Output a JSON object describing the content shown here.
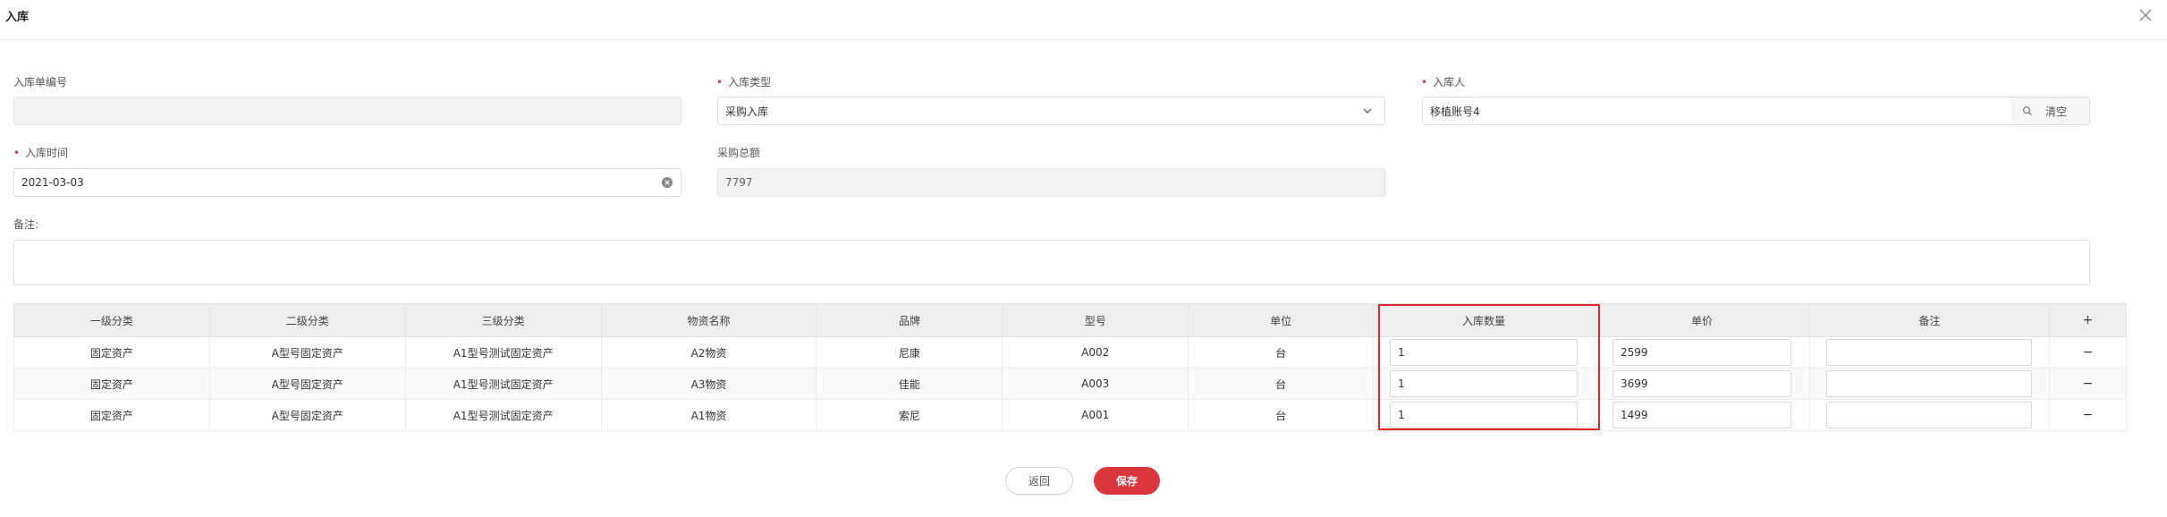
{
  "dialog": {
    "title": "入库"
  },
  "form": {
    "order_no": {
      "label": "入库单编号",
      "value": ""
    },
    "type": {
      "label": "入库类型",
      "value": "采购入库"
    },
    "person": {
      "label": "入库人",
      "value": "移植账号4",
      "clear_label": "清空"
    },
    "date": {
      "label": "入库时间",
      "value": "2021-03-03"
    },
    "total": {
      "label": "采购总额",
      "value": "7797"
    },
    "remark": {
      "label": "备注:"
    }
  },
  "table": {
    "columns": [
      "一级分类",
      "二级分类",
      "三级分类",
      "物资名称",
      "品牌",
      "型号",
      "单位",
      "入库数量",
      "单价",
      "备注",
      "+"
    ],
    "rows": [
      {
        "cat1": "固定资产",
        "cat2": "A型号固定资产",
        "cat3": "A1型号测试固定资产",
        "name": "A2物资",
        "brand": "尼康",
        "model": "A002",
        "unit": "台",
        "qty": "1",
        "price": "2599",
        "remark": "",
        "op": "−"
      },
      {
        "cat1": "固定资产",
        "cat2": "A型号固定资产",
        "cat3": "A1型号测试固定资产",
        "name": "A3物资",
        "brand": "佳能",
        "model": "A003",
        "unit": "台",
        "qty": "1",
        "price": "3699",
        "remark": "",
        "op": "−"
      },
      {
        "cat1": "固定资产",
        "cat2": "A型号固定资产",
        "cat3": "A1型号测试固定资产",
        "name": "A1物资",
        "brand": "索尼",
        "model": "A001",
        "unit": "台",
        "qty": "1",
        "price": "1499",
        "remark": "",
        "op": "−"
      }
    ]
  },
  "actions": {
    "back_label": "返回",
    "save_label": "保存"
  },
  "colors": {
    "accent": "#d9353a",
    "highlight": "#e0272a",
    "required": "#e4393c"
  },
  "icons": {
    "close": "close-icon",
    "dropdown": "chevron-down-icon",
    "clear": "clear-circle-icon",
    "search": "search-icon"
  }
}
